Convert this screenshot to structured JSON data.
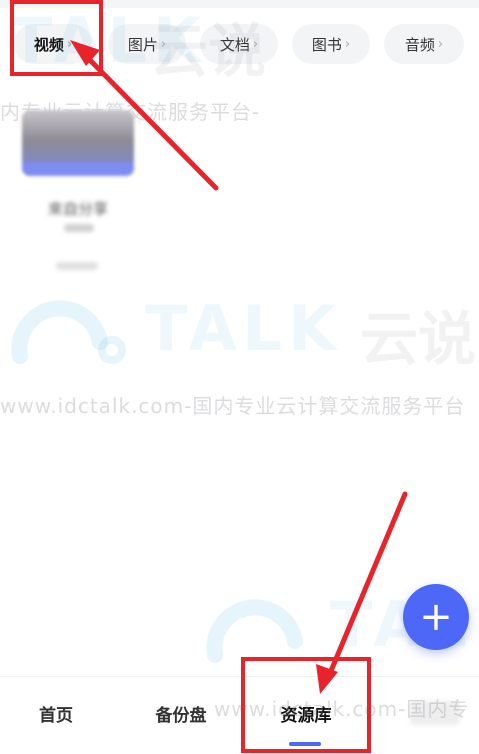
{
  "categories": [
    {
      "label": "视频",
      "active": true
    },
    {
      "label": "图片"
    },
    {
      "label": "文档"
    },
    {
      "label": "图书"
    },
    {
      "label": "音频"
    }
  ],
  "chevron": "›",
  "album": {
    "title": "來自分享"
  },
  "fab": {
    "icon": "plus-icon",
    "symbol": "+"
  },
  "bottom_nav": [
    {
      "label": "首页"
    },
    {
      "label": "备份盘"
    },
    {
      "label": "资源库",
      "active": true
    }
  ],
  "watermark": {
    "logo_text": "TALK",
    "cn": "云说",
    "url_line": "www.idctalk.com-国内专业云计算交流服务平台",
    "url_line_top": "内专业云计算交流服务平台-",
    "url_line_bottom": "www.idctalk.com-国内专"
  },
  "colors": {
    "accent": "#4d68f6",
    "annotation": "#e8232a",
    "chip_bg": "#f3f4f6"
  }
}
